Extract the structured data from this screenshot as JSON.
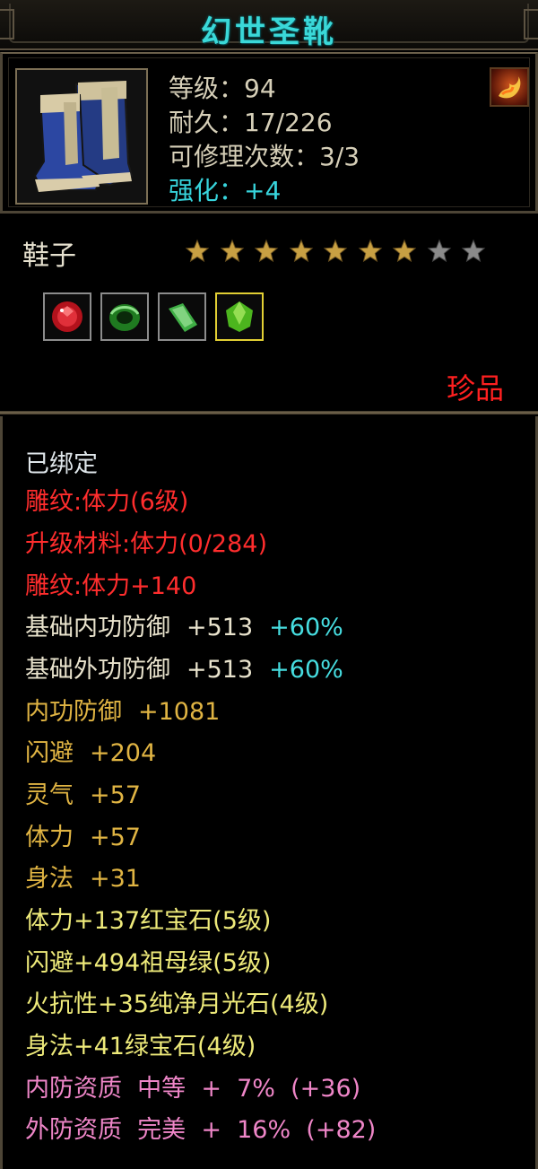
{
  "window": {
    "title": "幻世圣靴"
  },
  "item": {
    "icon": "blue-boots-icon",
    "stats": {
      "level": "等级：94",
      "durability": "耐久：17/226",
      "repair_count": "可修理次数：3/3",
      "enhance": "强化：+4"
    },
    "school_icon": "flame-school-icon"
  },
  "type": "鞋子",
  "stars": {
    "filled": 7,
    "total": 9,
    "filled_color": "#c8a043",
    "empty_color": "#8a8a8a"
  },
  "gems": [
    {
      "icon": "red-ruby-gem-icon",
      "color": "#d81b24",
      "selected": false
    },
    {
      "icon": "green-emerald-ring-gem-icon",
      "color": "#2aa32a",
      "selected": false
    },
    {
      "icon": "green-crystal-gem-icon",
      "color": "#4cc24c",
      "selected": false
    },
    {
      "icon": "green-cut-gem-icon",
      "color": "#5bd12a",
      "selected": true
    }
  ],
  "rarity": "珍品",
  "attributes": {
    "bound": "已绑定",
    "carving_level": "雕纹:体力(6级)",
    "upgrade_material": "升级材料:体力(0/284)",
    "carving_bonus": "雕纹:体力+140",
    "base_inner_defense": {
      "label": "基础内功防御",
      "value": "+513",
      "percent": "+60%"
    },
    "base_outer_defense": {
      "label": "基础外功防御",
      "value": "+513",
      "percent": "+60%"
    },
    "inner_defense": {
      "label": "内功防御",
      "value": "+1081"
    },
    "dodge": {
      "label": "闪避",
      "value": "+204"
    },
    "spirit": {
      "label": "灵气",
      "value": "+57"
    },
    "stamina": {
      "label": "体力",
      "value": "+57"
    },
    "agility": {
      "label": "身法",
      "value": "+31"
    },
    "gem_bonus_1": "体力+137红宝石(5级)",
    "gem_bonus_2": "闪避+494祖母绿(5级)",
    "gem_bonus_3": "火抗性+35纯净月光石(4级)",
    "gem_bonus_4": "身法+41绿宝石(4级)",
    "inner_quality": "内防资质  中等  +  7%  (+36)",
    "outer_quality": "外防资质  完美  +  16%  (+82)"
  }
}
